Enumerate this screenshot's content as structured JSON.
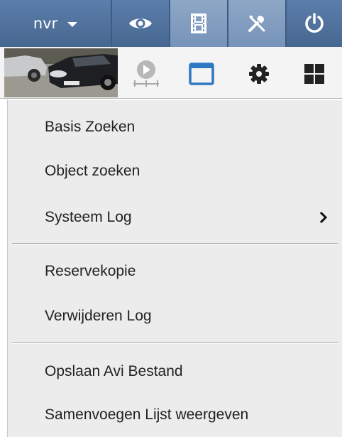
{
  "toolbar": {
    "user_label": "nvr",
    "buttons": [
      {
        "name": "live-view",
        "icon": "eye-icon"
      },
      {
        "name": "playback",
        "icon": "film-icon"
      },
      {
        "name": "setup",
        "icon": "tools-icon"
      },
      {
        "name": "power",
        "icon": "power-icon"
      }
    ],
    "colors": {
      "bar": "#4d6f9a",
      "active": "#7f9bc0",
      "icon": "#ffffff"
    }
  },
  "row2": {
    "thumbnail": "camera-thumbnail",
    "icons": [
      "playback-timeline-icon",
      "window-icon",
      "gear-icon",
      "grid-icon"
    ],
    "colors": {
      "window_icon": "#2f78c4",
      "dark_icon": "#222222",
      "disabled_icon": "#a8a8a8"
    }
  },
  "menu": {
    "items": [
      {
        "label": "Basis Zoeken"
      },
      {
        "label": "Object zoeken"
      },
      {
        "label": "Systeem Log",
        "has_submenu": true
      },
      {
        "label": "Reservekopie"
      },
      {
        "label": "Verwijderen Log"
      },
      {
        "label": "Opslaan Avi Bestand"
      },
      {
        "label": "Samenvoegen Lijst weergeven"
      }
    ],
    "submenu_icon": "chevron-right-icon"
  }
}
